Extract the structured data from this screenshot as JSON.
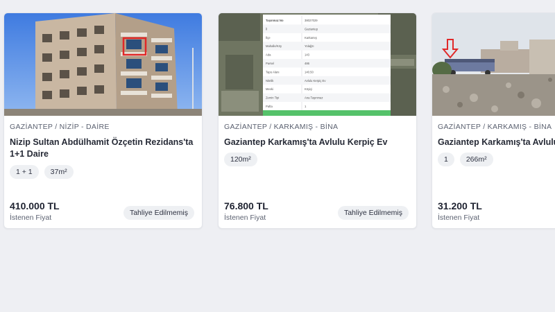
{
  "listings": [
    {
      "photo": "apartment-building-photo",
      "category": "GAZİANTEP / NİZİP - DAİRE",
      "title": "Nizip Sultan Abdülhamit Özçetin Rezidans'ta 1+1 Daire",
      "chips": [
        "1 + 1",
        "37m²"
      ],
      "price": "410.000 TL",
      "price_label": "İstenen Fiyat",
      "status": "Tahliye Edilmemiş"
    },
    {
      "photo": "satellite-map-with-parcel-table",
      "category": "GAZİANTEP / KARKAMIŞ - BİNA",
      "title": "Gaziantep Karkamış'ta Avlulu Kerpiç Ev",
      "chips": [
        "120m²"
      ],
      "price": "76.800 TL",
      "price_label": "İstenen Fiyat",
      "status": "Tahliye Edilmemiş"
    },
    {
      "photo": "rural-yard-photo",
      "category": "GAZİANTEP / KARKAMIŞ - BİNA",
      "title": "Gaziantep Karkamış'ta Avlulu Ke",
      "chips": [
        "1",
        "266m²"
      ],
      "price": "31.200 TL",
      "price_label": "İstenen Fiyat"
    }
  ],
  "parcel_table": {
    "rows": [
      [
        "Taşınmaz No",
        "38027029"
      ],
      [
        "İl",
        "Gaziantep"
      ],
      [
        "İlçe",
        "Karkamış"
      ],
      [
        "Mahalle/Köy",
        "Yolağzı"
      ],
      [
        "Ada",
        "143"
      ],
      [
        "Parsel",
        "486"
      ],
      [
        "Tapu Alanı",
        "140.50"
      ],
      [
        "Nitelik",
        "Avlulu Kerpiç Ev"
      ],
      [
        "Mevki",
        "Köyiçi"
      ],
      [
        "Zemin Tipi",
        "Ana Taşınmaz"
      ],
      [
        "Pafta",
        "1"
      ]
    ]
  },
  "colors": {
    "background": "#eeeff3",
    "card": "#ffffff",
    "chip": "#eef0f3",
    "table_accent": "#55c26a"
  }
}
